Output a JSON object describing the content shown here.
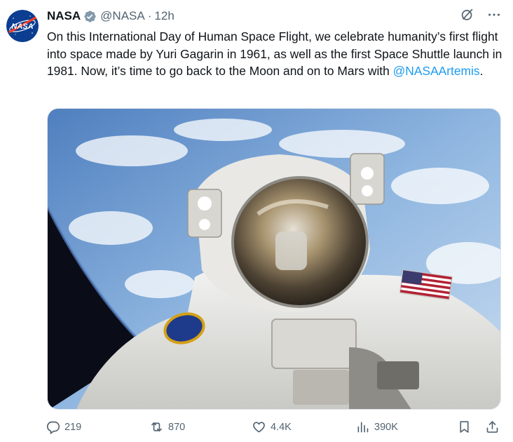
{
  "tweet": {
    "author": {
      "name": "NASA",
      "handle": "@NASA",
      "separator": "·",
      "time": "12h",
      "avatar_text": "NASA",
      "verified_color": "#829aab"
    },
    "text": {
      "before": "On this International Day of Human Space Flight, we celebrate humanity’s first flight into space made by Yuri Gagarin in 1961, as well as the first Space Shuttle launch in 1981. Now, it’s time to go back to the Moon and on to Mars with ",
      "mention": "@NASAArtemis",
      "after": "."
    },
    "media": {
      "icon": "astronaut-selfie-image"
    },
    "stats": {
      "replies": "219",
      "reposts": "870",
      "likes": "4.4K",
      "views": "390K"
    },
    "colors": {
      "accent": "#1d9bf0",
      "muted": "#536471"
    }
  }
}
